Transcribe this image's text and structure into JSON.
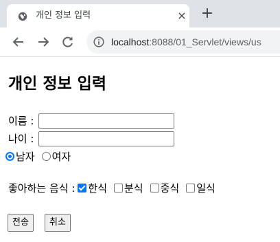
{
  "browser": {
    "tab": {
      "title": "개인 정보 입력",
      "close_glyph": "×"
    },
    "new_tab_glyph": "+",
    "url": {
      "host": "localhost",
      "rest": ":8088/01_Servlet/views/us"
    }
  },
  "page": {
    "title": "개인 정보 입력",
    "name_label": "이름 :",
    "name_value": "",
    "age_label": "나이 :",
    "age_value": "",
    "gender": {
      "options": [
        {
          "label": "남자",
          "checked": true
        },
        {
          "label": "여자",
          "checked": false
        }
      ]
    },
    "food": {
      "label": "좋아하는 음식 :",
      "options": [
        {
          "label": "한식",
          "checked": true
        },
        {
          "label": "분식",
          "checked": false
        },
        {
          "label": "중식",
          "checked": false
        },
        {
          "label": "일식",
          "checked": false
        }
      ]
    },
    "buttons": {
      "submit": "전송",
      "cancel": "취소"
    }
  },
  "colors": {
    "accent": "#0075ff",
    "tabstrip": "#dee1e6",
    "omnibox": "#f1f3f4"
  }
}
